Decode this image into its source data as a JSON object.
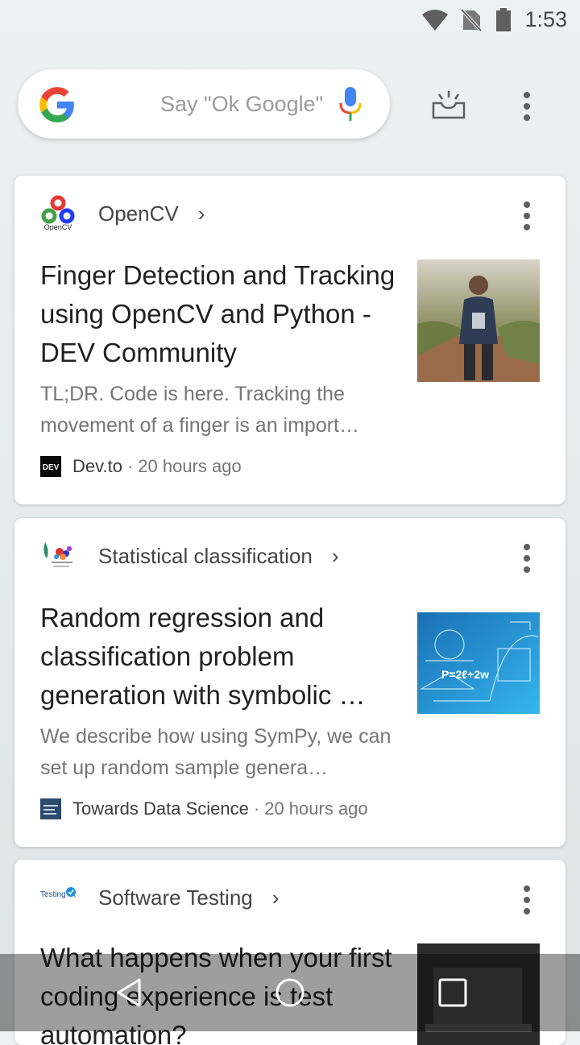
{
  "status": {
    "time": "1:53",
    "wifi_icon": "wifi-icon",
    "no_sim_icon": "no-sim-icon",
    "battery_icon": "battery-icon"
  },
  "search": {
    "hint": "Say \"Ok Google\"",
    "logo": "google-logo",
    "mic": "mic-icon"
  },
  "header": {
    "tray_icon": "updates-tray-icon",
    "menu_icon": "more-vert-icon"
  },
  "cards": [
    {
      "topic": "OpenCV",
      "title": "Finger Detection and Tracking using OpenCV and Python - DEV Community",
      "snippet": "TL;DR. Code is here. Tracking the movement of a finger is an import…",
      "source": "Dev.to",
      "time": "20 hours ago",
      "source_logo_text": "DEV"
    },
    {
      "topic": "Statistical classification",
      "title": "Random regression and classification problem generation with symbolic …",
      "snippet": "We describe how using SymPy, we can set up random sample genera…",
      "source": "Towards Data Science",
      "time": "20 hours ago"
    },
    {
      "topic": "Software Testing",
      "title": "What happens when your first coding experience is test automation?",
      "snippet": "",
      "source": "",
      "time": "",
      "topic_logo_text": "Testing Software"
    }
  ],
  "thumb2_formula": "P=2ℓ+2w",
  "opencv_logo_text": "OpenCV",
  "navbar": {
    "back": "back-icon",
    "home": "home-icon",
    "recents": "recents-icon"
  },
  "colors": {
    "google_blue": "#4285F4",
    "google_red": "#EA4335",
    "google_yellow": "#FBBC05",
    "google_green": "#34A853"
  }
}
